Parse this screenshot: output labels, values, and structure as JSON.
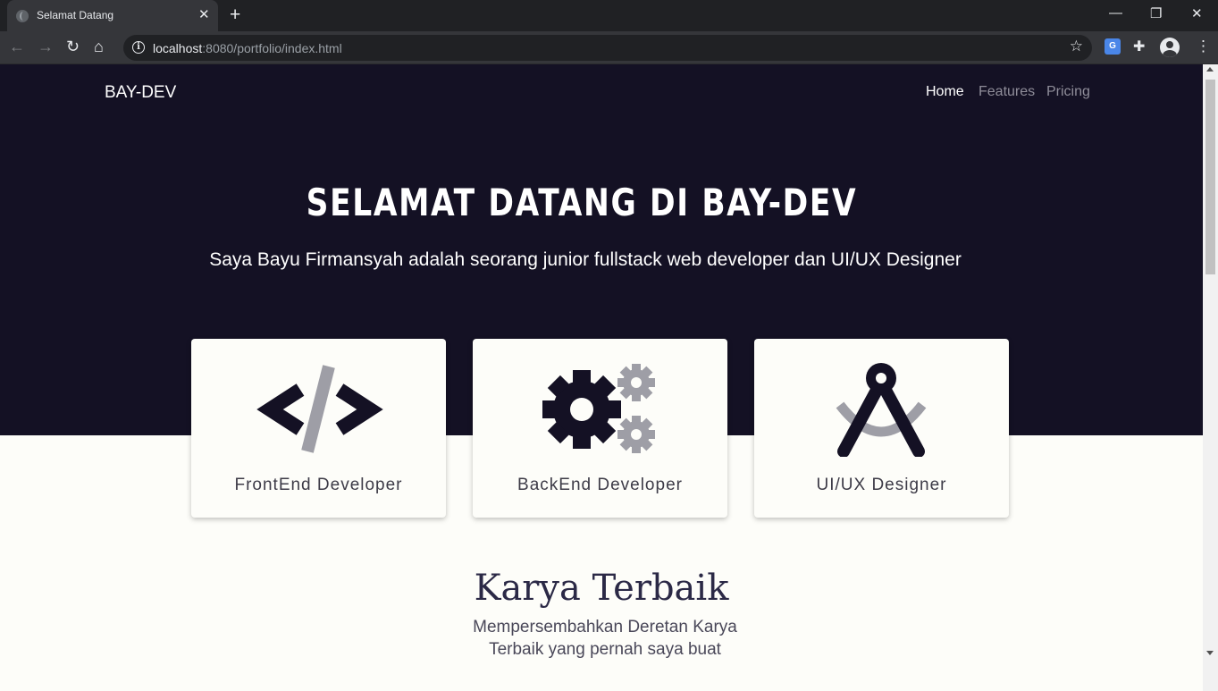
{
  "browser": {
    "tab_title": "Selamat Datang",
    "url_host": "localhost",
    "url_rest": ":8080/portfolio/index.html"
  },
  "site": {
    "brand": "BAY-DEV",
    "nav": [
      {
        "label": "Home",
        "active": true
      },
      {
        "label": "Features",
        "active": false
      },
      {
        "label": "Pricing",
        "active": false
      }
    ],
    "hero_title": "SELAMAT DATANG DI BAY-DEV",
    "hero_subtitle": "Saya Bayu Firmansyah adalah seorang junior fullstack web developer dan UI/UX Designer",
    "cards": [
      {
        "label": "FrontEnd Developer",
        "icon": "code-icon"
      },
      {
        "label": "BackEnd Developer",
        "icon": "gears-icon"
      },
      {
        "label": "UI/UX Designer",
        "icon": "compass-drafting-icon"
      }
    ],
    "section_title": "Karya Terbaik",
    "section_subtitle": "Mempersembahkan Deretan Karya Terbaik yang pernah saya buat"
  },
  "colors": {
    "hero_bg": "#141124",
    "page_bg": "#fdfdf9",
    "icon_dark": "#141124",
    "icon_gray": "#9e9ea6"
  }
}
